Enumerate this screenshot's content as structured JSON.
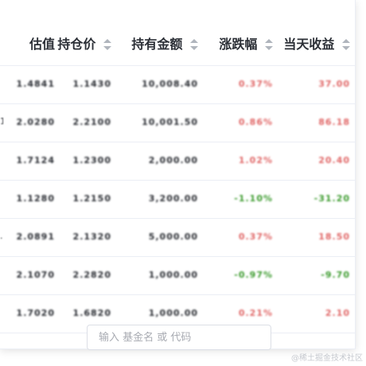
{
  "table": {
    "columns": [
      {
        "label": "估值",
        "sortable": false
      },
      {
        "label": "持仓价",
        "sortable": true
      },
      {
        "label": "持有金额",
        "sortable": true
      },
      {
        "label": "涨跌幅",
        "sortable": true
      },
      {
        "label": "当天收益",
        "sortable": true
      }
    ],
    "rows": [
      {
        "edge": "",
        "estimate": "1.4841",
        "cost": "1.1430",
        "amount": "10,008.40",
        "change": "0.37%",
        "profit": "37.00",
        "trend": "up"
      },
      {
        "edge": "1",
        "estimate": "2.0280",
        "cost": "2.2100",
        "amount": "10,001.50",
        "change": "0.86%",
        "profit": "86.18",
        "trend": "up"
      },
      {
        "edge": "",
        "estimate": "1.7124",
        "cost": "1.2300",
        "amount": "2,000.00",
        "change": "1.02%",
        "profit": "20.40",
        "trend": "up"
      },
      {
        "edge": "",
        "estimate": "1.1280",
        "cost": "1.2150",
        "amount": "3,200.00",
        "change": "-1.10%",
        "profit": "-31.20",
        "trend": "down"
      },
      {
        "edge": ".",
        "estimate": "2.0891",
        "cost": "2.1320",
        "amount": "5,000.00",
        "change": "0.37%",
        "profit": "18.50",
        "trend": "up"
      },
      {
        "edge": "",
        "estimate": "2.1070",
        "cost": "2.2820",
        "amount": "1,000.00",
        "change": "-0.97%",
        "profit": "-9.70",
        "trend": "down"
      },
      {
        "edge": "",
        "estimate": "1.7020",
        "cost": "1.6820",
        "amount": "1,000.00",
        "change": "0.21%",
        "profit": "2.10",
        "trend": "up"
      }
    ]
  },
  "search": {
    "placeholder": "输入 基金名 或 代码",
    "value": ""
  },
  "watermark": "@稀土掘金技术社区",
  "colors": {
    "up": "#e06666",
    "down": "#3a9a2c",
    "text": "#2a2d33",
    "border": "#ebeef5"
  }
}
